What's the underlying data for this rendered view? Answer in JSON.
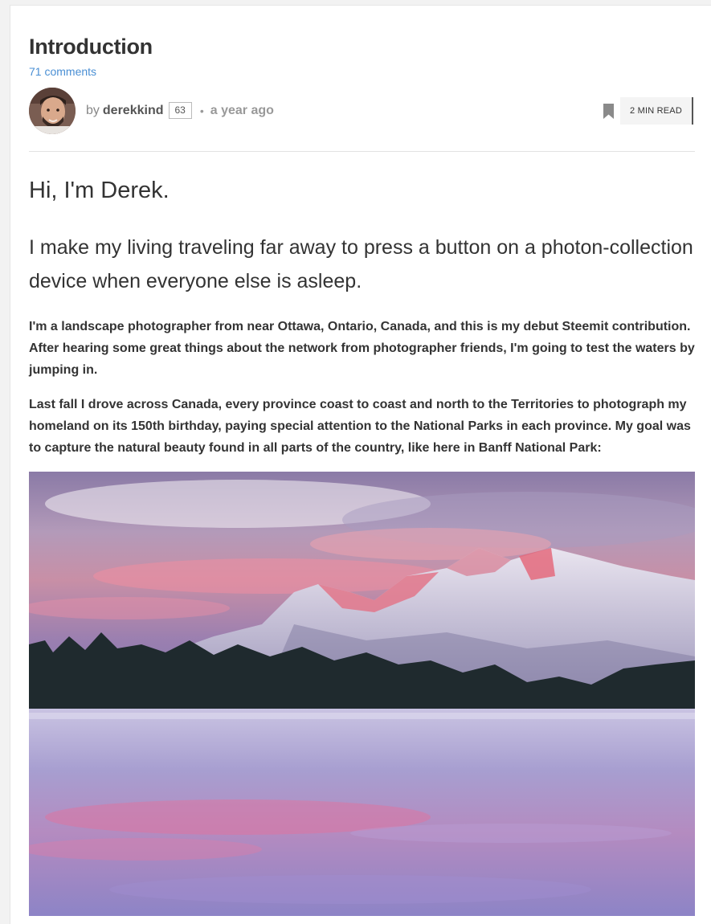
{
  "post": {
    "title": "Introduction",
    "comments_label": "71 comments",
    "by_label": "by",
    "author": "derekkind",
    "reputation": "63",
    "separator": "•",
    "time_ago": "a year ago",
    "read_time": "2 MIN READ"
  },
  "body": {
    "heading": "Hi, I'm Derek.",
    "subheading": "I make my living traveling far away to press a button on a photon-collection device when everyone else is asleep.",
    "paragraph_1": "I'm a landscape photographer from near Ottawa, Ontario, Canada, and this is my debut Steemit contribution. After hearing some great things about the network from photographer friends, I'm going to test the waters by jumping in.",
    "paragraph_2": "Last fall I drove across Canada, every province coast to coast and north to the Territories to photograph my homeland on its 150th birthday, paying special attention to the National Parks in each province. My goal was to capture the natural beauty found in all parts of the country, like here in Banff National Park:"
  },
  "colors": {
    "link": "#4a8fd4",
    "text": "#333333",
    "muted": "#999999"
  },
  "icons": {
    "bookmark": "bookmark-icon"
  }
}
